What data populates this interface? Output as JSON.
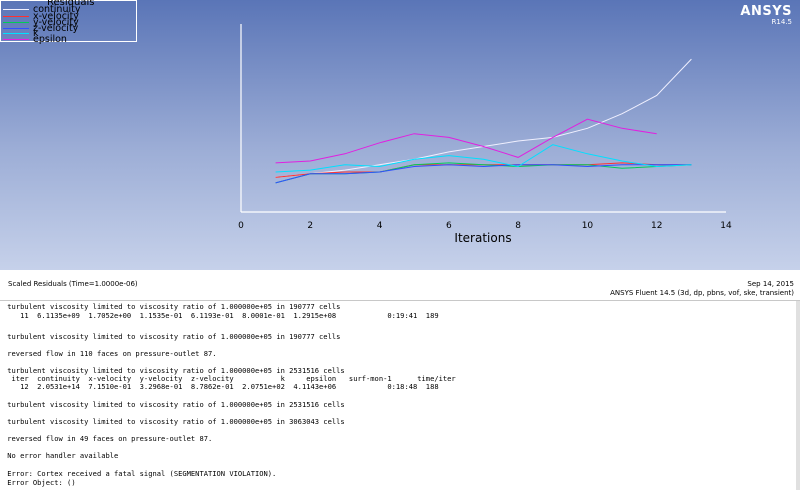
{
  "app": {
    "brand": "ANSYS",
    "version": "R14.5"
  },
  "legend": {
    "title": "Residuals",
    "items": [
      {
        "name": "continuity",
        "color": "#f0f0ff"
      },
      {
        "name": "x-velocity",
        "color": "#ff3030"
      },
      {
        "name": "y-velocity",
        "color": "#00cc55"
      },
      {
        "name": "z-velocity",
        "color": "#3050ff"
      },
      {
        "name": "k",
        "color": "#00e0ff"
      },
      {
        "name": "epsilon",
        "color": "#e020e0"
      }
    ]
  },
  "chart_data": {
    "type": "line",
    "xlabel": "Iterations",
    "xlim": [
      0,
      14
    ],
    "xticks": [
      "0",
      "2",
      "4",
      "6",
      "8",
      "10",
      "12",
      "14"
    ],
    "ylim": [
      0,
      1
    ],
    "series": [
      {
        "name": "continuity",
        "color": "#f0f0ff",
        "x": [
          1,
          2,
          3,
          4,
          5,
          6,
          7,
          8,
          9,
          10,
          11,
          12,
          13
        ],
        "y": [
          0.19,
          0.21,
          0.23,
          0.26,
          0.29,
          0.33,
          0.36,
          0.39,
          0.41,
          0.46,
          0.54,
          0.64,
          0.84
        ]
      },
      {
        "name": "x-velocity",
        "color": "#ff3030",
        "x": [
          1,
          2,
          3,
          4,
          5,
          6,
          7,
          8,
          9,
          10,
          11,
          12,
          13
        ],
        "y": [
          0.19,
          0.21,
          0.22,
          0.22,
          0.26,
          0.26,
          0.26,
          0.26,
          0.26,
          0.26,
          0.27,
          0.26,
          0.26
        ]
      },
      {
        "name": "y-velocity",
        "color": "#00cc55",
        "x": [
          1,
          2,
          3,
          4,
          5,
          6,
          7,
          8,
          9,
          10,
          11,
          12,
          13
        ],
        "y": [
          0.16,
          0.21,
          0.21,
          0.22,
          0.26,
          0.27,
          0.26,
          0.25,
          0.26,
          0.26,
          0.24,
          0.25,
          0.26
        ]
      },
      {
        "name": "z-velocity",
        "color": "#3050ff",
        "x": [
          1,
          2,
          3,
          4,
          5,
          6,
          7,
          8,
          9,
          10,
          11,
          12,
          13
        ],
        "y": [
          0.16,
          0.21,
          0.21,
          0.22,
          0.25,
          0.26,
          0.25,
          0.26,
          0.26,
          0.25,
          0.26,
          0.26,
          0.26
        ]
      },
      {
        "name": "k",
        "color": "#00e0ff",
        "x": [
          1,
          2,
          3,
          4,
          5,
          6,
          7,
          8,
          9,
          10,
          11,
          12,
          13
        ],
        "y": [
          0.22,
          0.23,
          0.26,
          0.25,
          0.29,
          0.31,
          0.29,
          0.25,
          0.37,
          0.32,
          0.28,
          0.25,
          0.26
        ]
      },
      {
        "name": "epsilon",
        "color": "#e020e0",
        "x": [
          1,
          2,
          3,
          4,
          5,
          6,
          7,
          8,
          9,
          10,
          11,
          12
        ],
        "y": [
          0.27,
          0.28,
          0.32,
          0.38,
          0.43,
          0.41,
          0.36,
          0.3,
          0.41,
          0.51,
          0.46,
          0.43
        ]
      }
    ]
  },
  "status": {
    "plot_name": "Scaled Residuals  (Time=1.0000e-06)",
    "date": "Sep 14, 2015",
    "product": "ANSYS Fluent 14.5 (3d, dp, pbns, vof, ske, transient)"
  },
  "console": {
    "lines": [
      " turbulent viscosity limited to viscosity ratio of 1.000000e+05 in 190777 cells",
      "    11  6.1135e+09  1.7052e+00  1.1535e-01  6.1193e-01  8.0001e-01  1.2915e+08            0:19:41  189",
      "",
      " turbulent viscosity limited to viscosity ratio of 1.000000e+05 in 190777 cells",
      "",
      " reversed flow in 110 faces on pressure-outlet 87.",
      "",
      " turbulent viscosity limited to viscosity ratio of 1.000000e+05 in 2531516 cells",
      "  iter  continuity  x-velocity  y-velocity  z-velocity           k     epsilon   surf-mon-1      time/iter",
      "    12  2.0531e+14  7.1510e-01  3.2968e-01  8.7862e-01  2.0751e+02  4.1143e+06            0:18:48  188",
      "",
      " turbulent viscosity limited to viscosity ratio of 1.000000e+05 in 2531516 cells",
      "",
      " turbulent viscosity limited to viscosity ratio of 1.000000e+05 in 3063043 cells",
      "",
      " reversed flow in 49 faces on pressure-outlet 87.",
      "",
      " No error handler available",
      "",
      " Error: Cortex received a fatal signal (SEGMENTATION VIOLATION).",
      " Error Object: ()"
    ]
  }
}
